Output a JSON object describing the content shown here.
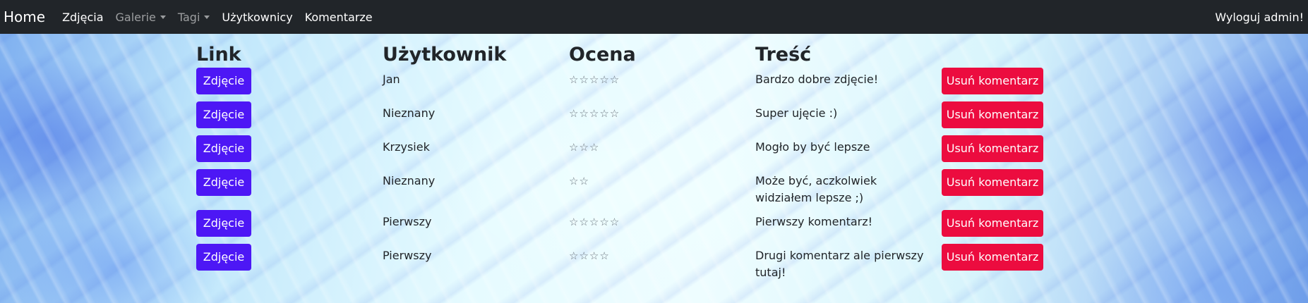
{
  "navbar": {
    "brand": "Home",
    "items": [
      {
        "label": "Zdjęcia",
        "dropdown": false,
        "muted": false
      },
      {
        "label": "Galerie",
        "dropdown": true,
        "muted": true
      },
      {
        "label": "Tagi",
        "dropdown": true,
        "muted": true
      },
      {
        "label": "Użytkownicy",
        "dropdown": false,
        "muted": false
      },
      {
        "label": "Komentarze",
        "dropdown": false,
        "muted": false
      }
    ],
    "logout": "Wyloguj admin!"
  },
  "table": {
    "headers": {
      "link": "Link",
      "user": "Użytkownik",
      "rating": "Ocena",
      "content": "Treść"
    },
    "rows": [
      {
        "link_label": "Zdjęcie",
        "user": "Jan",
        "stars": "☆☆☆☆☆",
        "rating": 5,
        "content": "Bardzo dobre zdjęcie!",
        "delete_label": "Usuń komentarz"
      },
      {
        "link_label": "Zdjęcie",
        "user": "Nieznany",
        "stars": "☆☆☆☆☆",
        "rating": 5,
        "content": "Super ujęcie :)",
        "delete_label": "Usuń komentarz"
      },
      {
        "link_label": "Zdjęcie",
        "user": "Krzysiek",
        "stars": "☆☆☆",
        "rating": 3,
        "content": "Mogło by być lepsze",
        "delete_label": "Usuń komentarz"
      },
      {
        "link_label": "Zdjęcie",
        "user": "Nieznany",
        "stars": "☆☆",
        "rating": 2,
        "content": "Może być, aczkolwiek widziałem lepsze ;)",
        "delete_label": "Usuń komentarz"
      },
      {
        "link_label": "Zdjęcie",
        "user": "Pierwszy",
        "stars": "☆☆☆☆☆",
        "rating": 5,
        "content": "Pierwszy komentarz!",
        "delete_label": "Usuń komentarz"
      },
      {
        "link_label": "Zdjęcie",
        "user": "Pierwszy",
        "stars": "☆☆☆☆",
        "rating": 4,
        "content": "Drugi komentarz ale pierwszy tutaj!",
        "delete_label": "Usuń komentarz"
      }
    ]
  },
  "colors": {
    "navbar": "#212529",
    "link_button": "#4d17f5",
    "delete_button": "#ec0c3f"
  }
}
